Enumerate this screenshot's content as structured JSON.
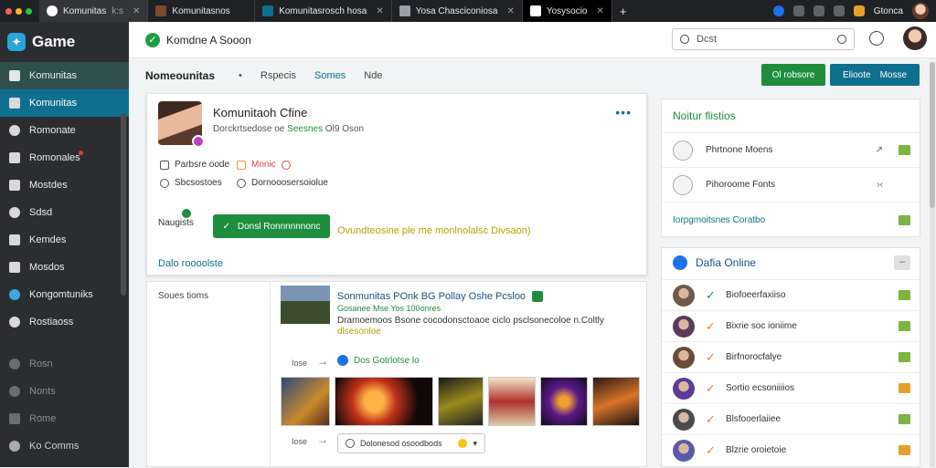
{
  "browser": {
    "tabs": [
      {
        "label": "Komunitas",
        "suffix": "k:s"
      },
      {
        "label": "Komunitasnos"
      },
      {
        "label": "Komunitasrosch hosa"
      },
      {
        "label": "Yosa Chasciconiosa"
      },
      {
        "label": "Yosysocio"
      }
    ],
    "right_label": "Gtonca"
  },
  "sidebar": {
    "brand": "Game",
    "items": [
      {
        "label": "Komunitas"
      },
      {
        "label": "Komunitas"
      },
      {
        "label": "Romonate"
      },
      {
        "label": "Romonales"
      },
      {
        "label": "Mostdes"
      },
      {
        "label": "Sdsd"
      },
      {
        "label": "Kemdes"
      },
      {
        "label": "Mosdos"
      },
      {
        "label": "Kongomtuniks"
      },
      {
        "label": "Rostiaoss"
      }
    ],
    "lower": [
      {
        "label": "Rosn"
      },
      {
        "label": "Nonts"
      },
      {
        "label": "Rome"
      },
      {
        "label": "Ko Comms"
      }
    ]
  },
  "appbar": {
    "title": "Komdne A Sooon",
    "search_placeholder": "Dcst"
  },
  "subnav": {
    "title": "Nomeounitas",
    "sep": "•",
    "links": [
      "Rspecis",
      "Somes",
      "Nde"
    ],
    "btn_green": "Ol robsore",
    "btn_teal": [
      "Elioote",
      "Mosse"
    ]
  },
  "profile": {
    "name": "Komunitaoh Cfine",
    "sub_a": "Dorckrtsedose oe",
    "sub_green": "Seesnes",
    "sub_b": "Ol9 Oson",
    "options": [
      {
        "label": "Parbsre oode"
      },
      {
        "label": "Mnnic"
      },
      {
        "label": "Sbcsostoes"
      },
      {
        "label": "Dornooosersoiolue"
      }
    ],
    "nav_label": "Naugists",
    "action": "Donsl Ronnnnnnonc",
    "note": "Ovundteosine ple me monlnolalsc Divsaon)",
    "link": "Dalo roooolste"
  },
  "feed": {
    "left_label": "Soues tioms",
    "post": {
      "title": "Sonmunitas POnk",
      "title_b": "BG Pollay Oshe Pcsloo",
      "meta": "Gosanee Mse Yos 100onres",
      "desc": "Dramoemoos Bsone cocodonsctoaoe ciclo psclsonecoloe n.Coltly",
      "desc_accent": "dlsesonloe"
    },
    "share": {
      "row_label": "Iose",
      "label": "Dos Gotrlotse lo"
    },
    "comment": {
      "row_label": "Iose",
      "placeholder": "Dolonesod osoodbods"
    }
  },
  "notifications": {
    "title": "Noitur flistios",
    "items": [
      {
        "label": "Phrtnone Moens",
        "action": "↗"
      },
      {
        "label": "Pihoroome Fonts",
        "action": "›‹"
      }
    ],
    "link": "Iorpgmoitsnes Coratbo"
  },
  "online": {
    "title": "Dafia Online",
    "minimize": "–",
    "users": [
      {
        "label": "Biofoeerfaxiiso",
        "check_color": "#1e8e3e",
        "status_color": "#7cb342"
      },
      {
        "label": "Bixrie soc ioniime",
        "check_color": "#e8832d",
        "status_color": "#7cb342"
      },
      {
        "label": "Birfnorocfalye",
        "check_color": "#e8832d",
        "status_color": "#7cb342"
      },
      {
        "label": "Sortio ecsoniiiios",
        "check_color": "#e8832d",
        "status_color": "#e8a02d"
      },
      {
        "label": "Blsfooerlaiiee",
        "check_color": "#e8832d",
        "status_color": "#7cb342"
      },
      {
        "label": "Blzrie oroietoie",
        "check_color": "#e8832d",
        "status_color": "#e8a02d"
      }
    ]
  },
  "colors": {
    "accent_green": "#1e8e3e",
    "accent_teal": "#0f6f8f",
    "sidebar_bg": "#2b2d30"
  }
}
